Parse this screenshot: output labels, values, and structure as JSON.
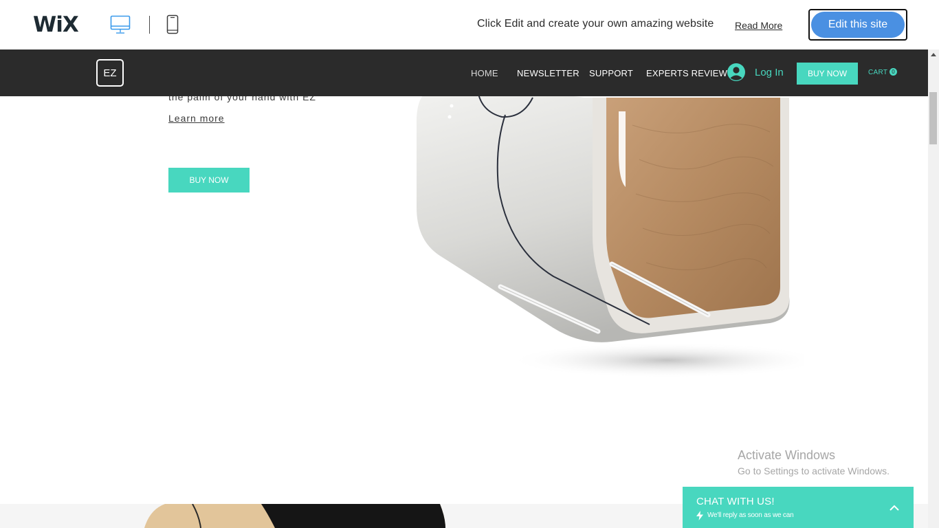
{
  "wix_bar": {
    "logo": "WiX",
    "promo_text": "Click Edit and create your own amazing website",
    "read_more": "Read More",
    "edit_button": "Edit this site",
    "device_icons": [
      "desktop-icon",
      "mobile-icon"
    ]
  },
  "site_nav": {
    "logo": "EZ",
    "items": [
      "HOME",
      "NEWSLETTER",
      "SUPPORT",
      "EXPERTS REVIEWS"
    ],
    "active": "HOME",
    "login": "Log In",
    "buy_now": "BUY NOW",
    "cart_label": "CART",
    "cart_count": "0"
  },
  "hero": {
    "text_partial": "the palm of your hand with EZ",
    "learn_more": "Learn more",
    "buy_now": "BUY NOW"
  },
  "windows_watermark": {
    "title": "Activate Windows",
    "subtitle": "Go to Settings to activate Windows."
  },
  "chat": {
    "title": "CHAT WITH US!",
    "subtitle": "We'll reply as soon as we can"
  },
  "colors": {
    "accent": "#48d7bf",
    "nav_bg": "#2b2b2b",
    "edit_button": "#4a90e2"
  }
}
